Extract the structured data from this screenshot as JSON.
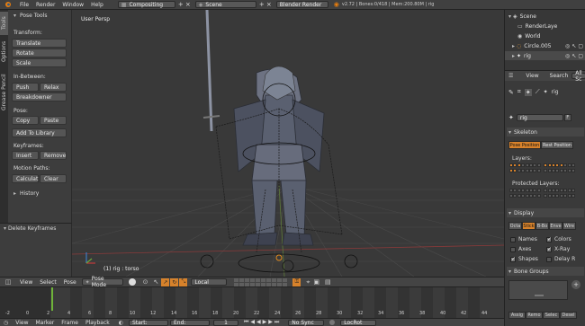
{
  "topbar": {
    "menus": [
      "File",
      "Render",
      "Window",
      "Help"
    ],
    "layout": "Compositing",
    "scene": "Scene",
    "engine": "Blender Render",
    "stats": "v2.72 | Bones:0/418 | Mem:200.80M | rig"
  },
  "tabs": [
    "Tools",
    "Options",
    "Grease Pencil"
  ],
  "toolshelf": {
    "title": "Pose Tools",
    "transform_label": "Transform:",
    "translate": "Translate",
    "rotate": "Rotate",
    "scale": "Scale",
    "inbetween_label": "In-Between:",
    "push": "Push",
    "relax": "Relax",
    "breakdowner": "Breakdowner",
    "pose_label": "Pose:",
    "copy": "Copy",
    "paste": "Paste",
    "add_library": "Add To Library",
    "keyframes_label": "Keyframes:",
    "insert": "Insert",
    "remove": "Remove",
    "motion_label": "Motion Paths:",
    "calculate": "Calculat",
    "clear": "Clear",
    "history": "History",
    "delete_keyframes": "Delete Keyframes"
  },
  "viewport": {
    "label": "User Persp",
    "status": "(1) rig : torso"
  },
  "vp_header": {
    "view": "View",
    "select": "Select",
    "pose": "Pose",
    "mode": "Pose Mode",
    "pivot": "Local"
  },
  "timeline": {
    "ticks": [
      "-2",
      "0",
      "2",
      "4",
      "6",
      "8",
      "10",
      "12",
      "14",
      "16",
      "18",
      "20",
      "22",
      "24",
      "26",
      "28",
      "30",
      "32",
      "34",
      "36",
      "38",
      "40",
      "42",
      "44"
    ],
    "current_frame": 1,
    "footer": {
      "view": "View",
      "marker": "Marker",
      "frame": "Frame",
      "playback": "Playback",
      "start": "Start:",
      "end": "End:",
      "current": "1",
      "sync": "No Sync",
      "keying": "LocRot"
    }
  },
  "outliner": {
    "rows": [
      {
        "label": "Scene",
        "indent": 0
      },
      {
        "label": "RenderLaye",
        "indent": 1
      },
      {
        "label": "World",
        "indent": 1
      },
      {
        "label": "Circle.005",
        "indent": 1
      },
      {
        "label": "rig",
        "indent": 1
      }
    ],
    "header_view": "View",
    "header_search": "Search",
    "header_all": "All Sc"
  },
  "properties": {
    "context": "rig",
    "datablock": "rig",
    "datablock_suffix": "F",
    "skeleton": "Skeleton",
    "pose_position": "Pose Position",
    "rest_position": "Rest Position",
    "layers": "Layers:",
    "protected_layers": "Protected Layers:",
    "display": "Display",
    "display_modes": [
      "Octa",
      "Stick",
      "B-Bo",
      "Enve",
      "Wire"
    ],
    "names": "Names",
    "colors": "Colors",
    "axes": "Axes",
    "xray": "X-Ray",
    "shapes": "Shapes",
    "delay": "Delay R",
    "bone_groups": "Bone Groups",
    "bg_assign": "Assig",
    "bg_remove": "Remo",
    "bg_select": "Selec",
    "bg_deselect": "Desel"
  },
  "colors": {
    "accent_orange": "#d7822b",
    "active_tab": "#5a5a5a",
    "grid": "#444444"
  }
}
